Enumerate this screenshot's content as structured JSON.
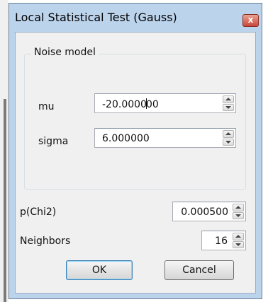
{
  "dialog": {
    "title": "Local Statistical Test (Gauss)",
    "close_glyph": "x"
  },
  "noise_model": {
    "group_label": "Noise model",
    "mu": {
      "label": "mu",
      "value_before_caret": "-20.0000",
      "value_after_caret": "00"
    },
    "sigma": {
      "label": "sigma",
      "value": "6.000000"
    }
  },
  "pchi2": {
    "label": "p(Chi2)",
    "value": "0.000500"
  },
  "neighbors": {
    "label": "Neighbors",
    "value": "16"
  },
  "buttons": {
    "ok": "OK",
    "cancel": "Cancel"
  },
  "colors": {
    "frame": "#bcd3ec",
    "client": "#f0f0f0",
    "close": "#c9473a"
  }
}
